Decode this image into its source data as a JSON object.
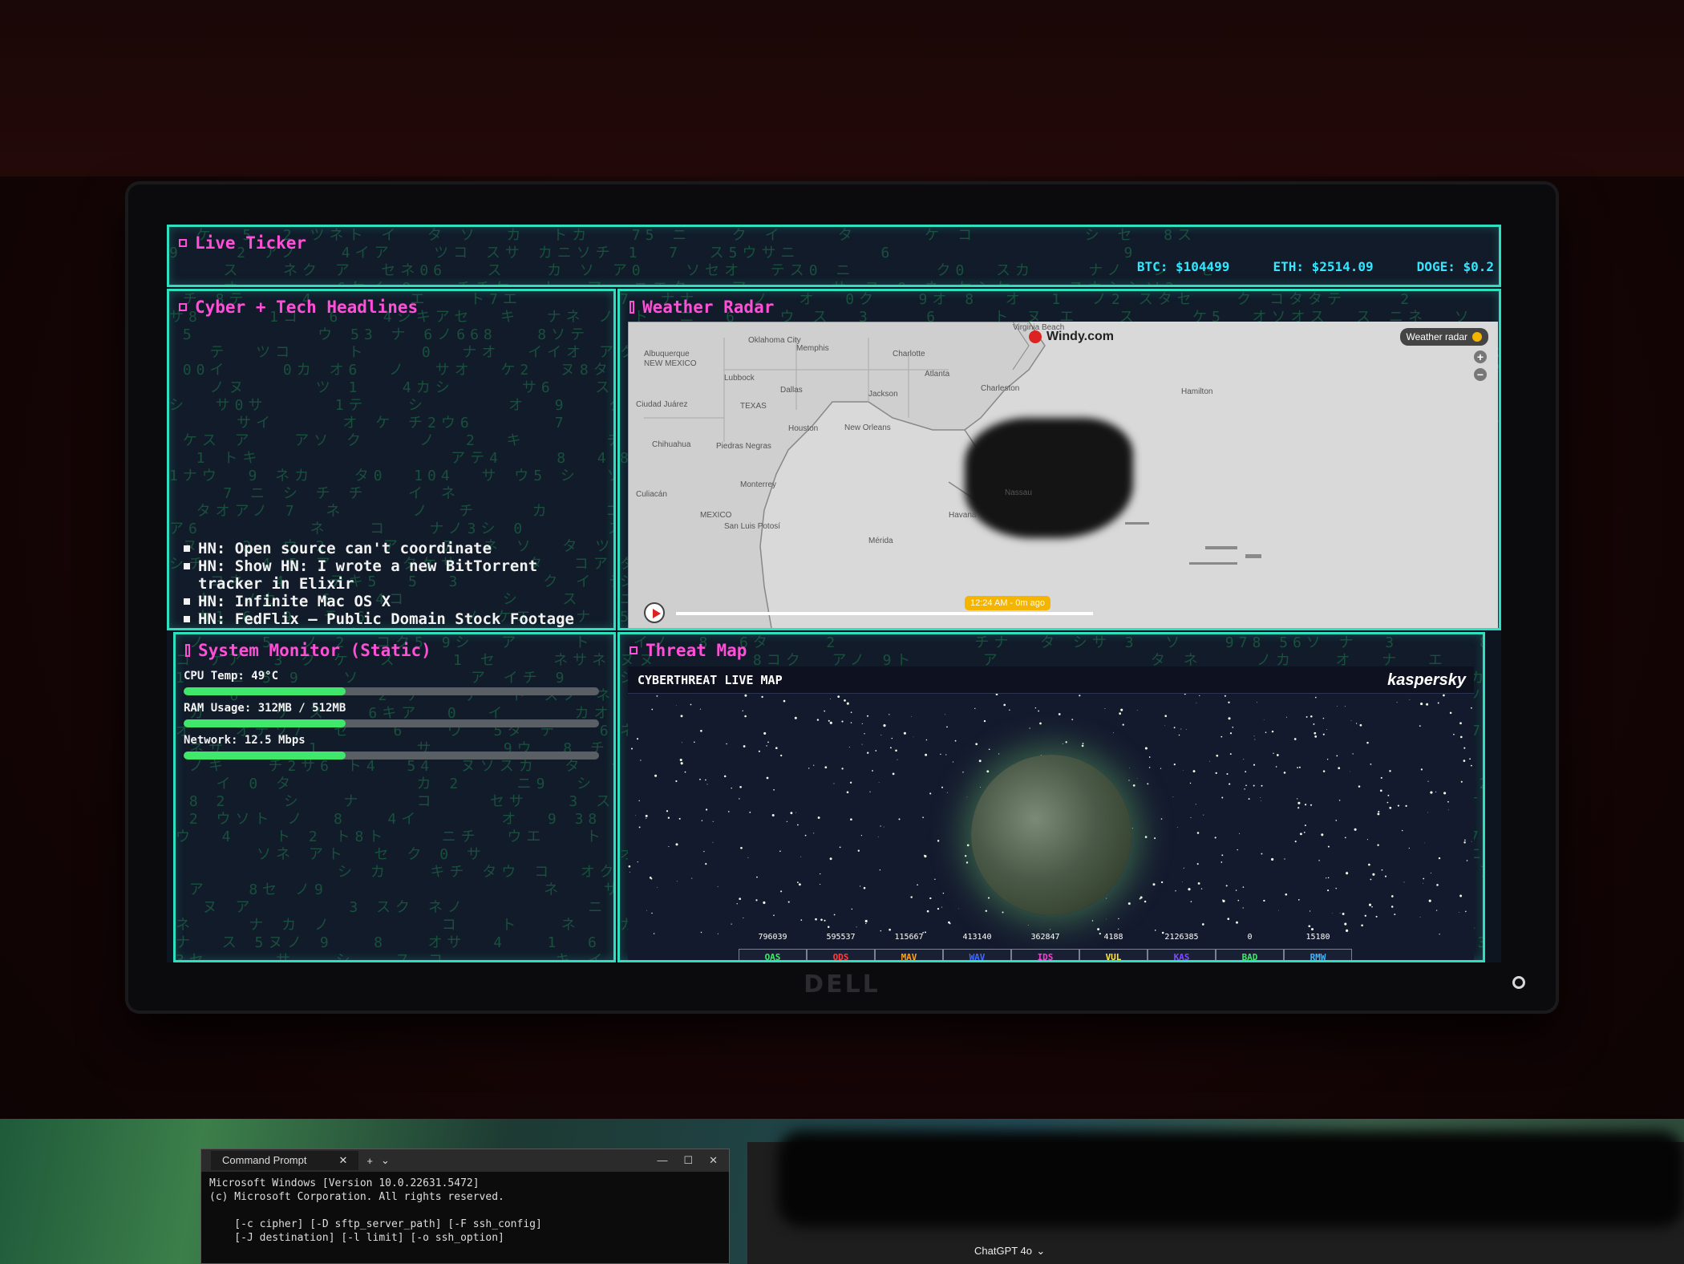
{
  "ticker": {
    "title": "Live Ticker",
    "btc": "BTC: $104499",
    "eth": "ETH: $2514.09",
    "doge": "DOGE: $0.2"
  },
  "headlines": {
    "title": "Cyber + Tech Headlines",
    "items": [
      "HN: Open source can't coordinate",
      "HN: Show HN: I wrote a new BitTorrent tracker in Elixir",
      "HN: Infinite Mac OS X",
      "HN: FedFlix – Public Domain Stock Footage"
    ]
  },
  "weather": {
    "title": "Weather Radar",
    "brand": "Windy.com",
    "layer_button": "Weather radar",
    "time_label": "12:24 AM - 0m ago",
    "places": [
      "Oklahoma City",
      "Memphis",
      "Charlotte",
      "Albuquerque",
      "NEW MEXICO",
      "Lubbock",
      "Dallas",
      "Atlanta",
      "Charleston",
      "TEXAS",
      "Jackson",
      "Ciudad Juárez",
      "Houston",
      "New Orleans",
      "Chihuahua",
      "Piedras Negras",
      "Monterrey",
      "Culiacán",
      "MEXICO",
      "San Luis Potosí",
      "Mérida",
      "Havana",
      "Nassau",
      "Hamilton",
      "Virginia Beach"
    ]
  },
  "sysmon": {
    "title": "System Monitor (Static)",
    "metrics": [
      {
        "label": "CPU Temp: 49°C",
        "level": 0.39
      },
      {
        "label": "RAM Usage: 312MB / 512MB",
        "level": 0.39
      },
      {
        "label": "Network: 12.5 Mbps",
        "level": 0.39
      }
    ]
  },
  "threat": {
    "title": "Threat Map",
    "map_title": "CYBERTHREAT LIVE MAP",
    "brand": "kaspersky",
    "stats": [
      {
        "num": "796039",
        "tag": "OAS",
        "color": "#3fe86a"
      },
      {
        "num": "595537",
        "tag": "ODS",
        "color": "#ff3b3b"
      },
      {
        "num": "115667",
        "tag": "MAV",
        "color": "#ff9f1a"
      },
      {
        "num": "413140",
        "tag": "WAV",
        "color": "#3b6bff"
      },
      {
        "num": "362847",
        "tag": "IDS",
        "color": "#ff3bd4"
      },
      {
        "num": "4188",
        "tag": "VUL",
        "color": "#ffe53b"
      },
      {
        "num": "2126385",
        "tag": "KAS",
        "color": "#7b4bff"
      },
      {
        "num": "0",
        "tag": "BAD",
        "color": "#3fe86a"
      },
      {
        "num": "15180",
        "tag": "RMW",
        "color": "#3bb4ff"
      }
    ]
  },
  "monitor": {
    "brand": "DELL"
  },
  "taskbar": {
    "cmd_title": "Command Prompt",
    "cmd_lines": [
      "Microsoft Windows [Version 10.0.22631.5472]",
      "(c) Microsoft Corporation. All rights reserved.",
      "",
      "    [-c cipher] [-D sftp_server_path] [-F ssh_config]",
      "    [-J destination] [-l limit] [-o ssh_option]"
    ],
    "chat_label": "ChatGPT 4o"
  }
}
